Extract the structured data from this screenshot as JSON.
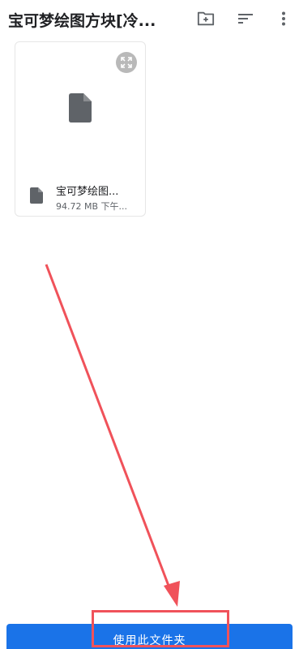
{
  "header": {
    "title": "宝可梦绘图方块[冷...",
    "new_folder_icon": "create-new-folder-icon",
    "sort_icon": "sort-icon",
    "more_icon": "more-vert-icon"
  },
  "files": [
    {
      "name": "宝可梦绘图...",
      "subtitle": "94.72 MB 下午...",
      "icon": "file-icon",
      "preview_icon": "file-icon",
      "expand_icon": "expand-icon"
    }
  ],
  "footer": {
    "use_folder_label": "使用此文件夹"
  },
  "colors": {
    "accent": "#1a73e8",
    "annotation": "#f0525a",
    "icon": "#5f6368",
    "text": "#202124"
  }
}
